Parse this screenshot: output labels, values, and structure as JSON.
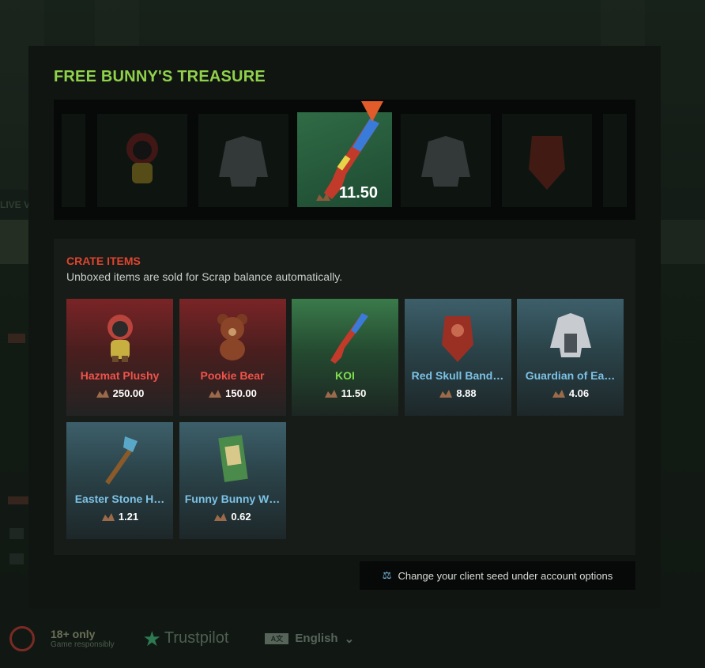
{
  "background": {
    "live_label": "LIVE V",
    "footer": {
      "age_main": "18+ only",
      "age_sub": "Game responsibly",
      "trustpilot": "Trustpilot",
      "language": "English",
      "language_icon": "A文"
    }
  },
  "modal": {
    "title": "FREE BUNNY'S TREASURE",
    "spinner": {
      "winning_value": "11.50",
      "slots": [
        {
          "icon": "hazmat-plushy-icon"
        },
        {
          "icon": "guardian-jacket-icon"
        },
        {
          "icon": "koi-rifle-icon"
        },
        {
          "icon": "guardian-jacket-icon"
        },
        {
          "icon": "red-skull-bandana-icon"
        }
      ]
    },
    "crate": {
      "title": "CRATE ITEMS",
      "subtitle": "Unboxed items are sold for Scrap balance automatically.",
      "items": [
        {
          "name": "Hazmat Plushy",
          "price": "250.00",
          "rarity": "red",
          "icon": "plushy-icon"
        },
        {
          "name": "Pookie Bear",
          "price": "150.00",
          "rarity": "red",
          "icon": "bear-icon"
        },
        {
          "name": "KOI",
          "price": "11.50",
          "rarity": "green",
          "icon": "rifle-icon"
        },
        {
          "name": "Red Skull Band…",
          "price": "8.88",
          "rarity": "blue",
          "icon": "bandana-icon"
        },
        {
          "name": "Guardian of Ea…",
          "price": "4.06",
          "rarity": "blue",
          "icon": "jacket-icon"
        },
        {
          "name": "Easter Stone H…",
          "price": "1.21",
          "rarity": "blue",
          "icon": "hatchet-icon"
        },
        {
          "name": "Funny Bunny W…",
          "price": "0.62",
          "rarity": "blue",
          "icon": "sign-icon"
        }
      ]
    },
    "seed_button": "Change your client seed under account options"
  },
  "colors": {
    "accent_green": "#8fd14a",
    "accent_red": "#e0452e",
    "rarity_blue": "#7cc2e6"
  }
}
